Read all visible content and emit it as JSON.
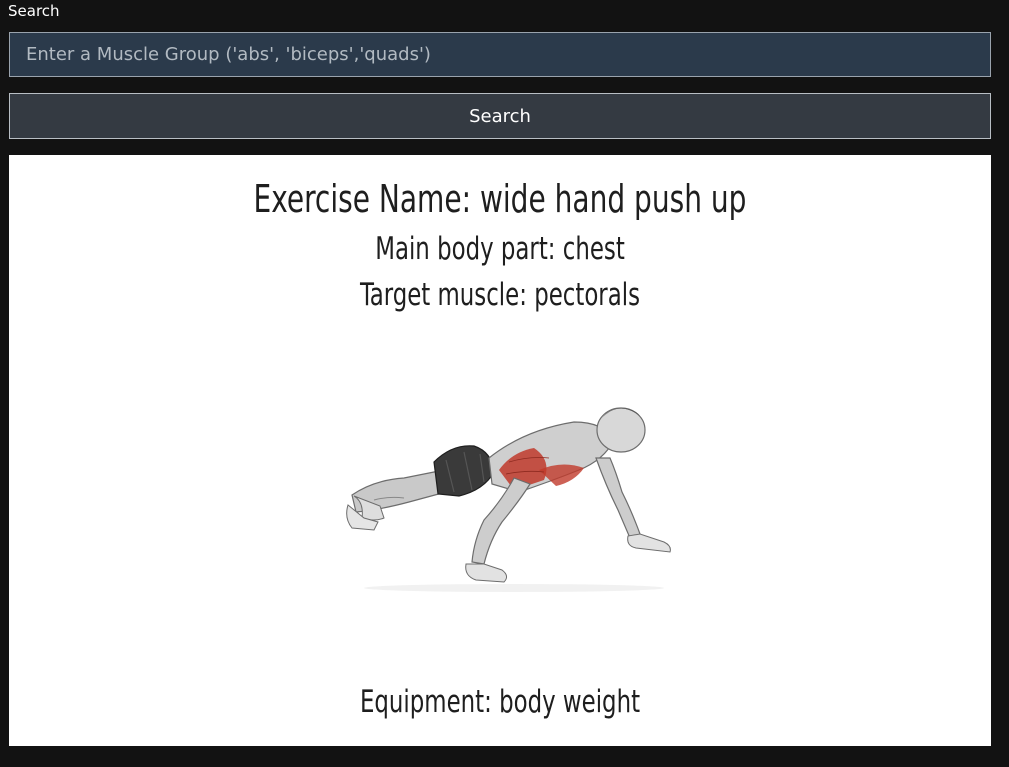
{
  "search": {
    "label": "Search",
    "placeholder": "Enter a Muscle Group ('abs', 'biceps','quads')",
    "value": "",
    "button_label": "Search"
  },
  "exercise": {
    "name": "Exercise Name: wide hand push up",
    "body_part": "Main body part: chest",
    "target": "Target muscle: pectorals",
    "equipment": "Equipment: body weight",
    "image_icon": "push-up-illustration"
  },
  "colors": {
    "page_bg": "#121212",
    "input_bg": "#2b3a4b",
    "button_bg": "#343a42",
    "card_bg": "#ffffff",
    "muscle_highlight": "#c0392b"
  }
}
